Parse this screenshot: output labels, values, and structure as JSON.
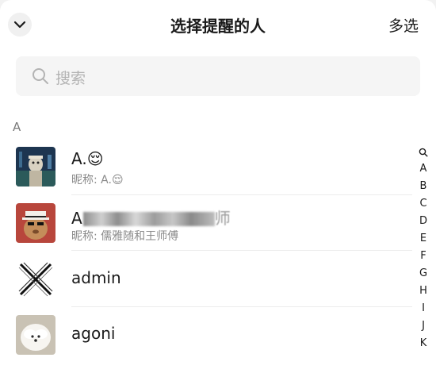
{
  "header": {
    "title": "选择提醒的人",
    "multi_select_label": "多选",
    "icons": {
      "collapse": "chevron-down-icon"
    }
  },
  "search": {
    "placeholder": "搜索",
    "icon": "search-icon"
  },
  "section_label": "A",
  "contacts": [
    {
      "name": "A.😌",
      "nickname": "昵称: A.😌"
    },
    {
      "name_prefix": "A",
      "name_suffix": "师",
      "nickname": "昵称: 儒雅随和王师傅"
    },
    {
      "name": "admin"
    },
    {
      "name": "agoni"
    }
  ],
  "index": {
    "search_icon": "search-icon",
    "letters": [
      "A",
      "B",
      "C",
      "D",
      "E",
      "F",
      "G",
      "H",
      "I",
      "J",
      "K"
    ]
  },
  "colors": {
    "text_primary": "#1a1a1a",
    "text_secondary": "#8a8a8a",
    "placeholder": "#b3b3b3",
    "search_bg": "#f5f5f5"
  }
}
